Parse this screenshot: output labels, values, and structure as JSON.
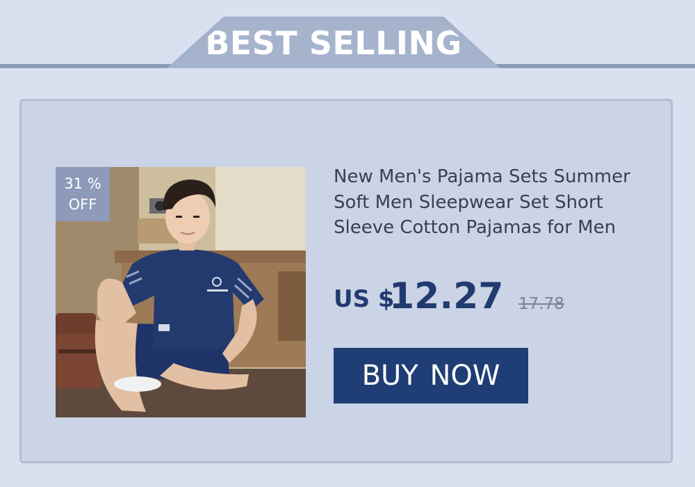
{
  "header": {
    "title": "BEST SELLING"
  },
  "product": {
    "discount_percent": "31 %",
    "discount_label": "OFF",
    "title_lines": [
      "New Men's Pajama Sets Summer",
      "Soft Men Sleepwear Set Short",
      "Sleeve Cotton Pajamas for Men"
    ],
    "image_icon": "product-photo-man-in-navy-pajamas",
    "currency": "US $",
    "price": "12.27",
    "original_price": "17.78",
    "buy_label": "BUY  NOW"
  },
  "colors": {
    "background": "#d9e0f0",
    "header_badge": "#a6b3cd",
    "card": "#cbd3e6",
    "discount_tag": "#8d9ab9",
    "price": "#213b70",
    "button": "#1f3e75",
    "pajama_navy": "#233a6e"
  }
}
